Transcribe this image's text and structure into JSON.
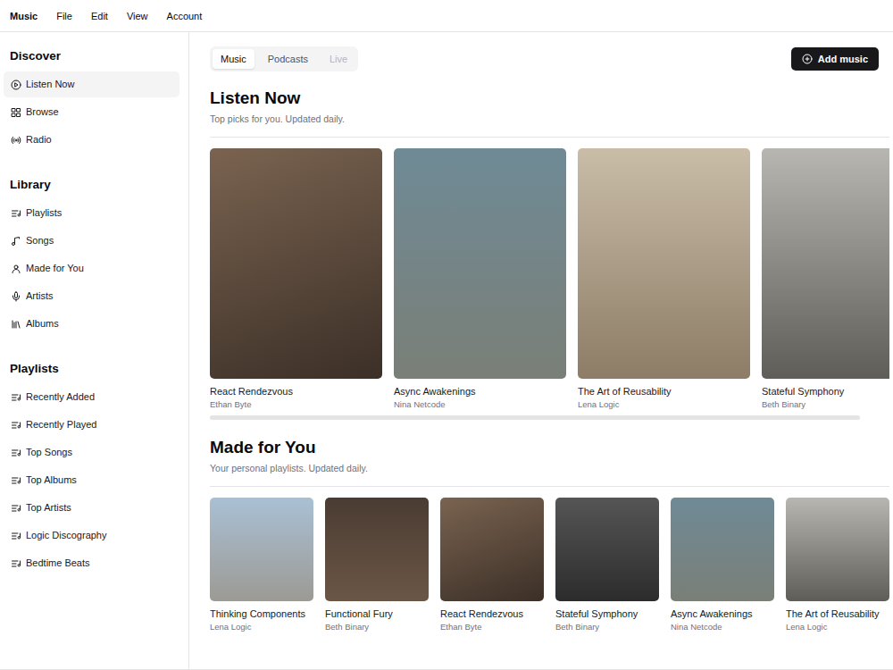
{
  "menubar": {
    "app": "Music",
    "menus": [
      "File",
      "Edit",
      "View",
      "Account"
    ]
  },
  "sidebar": [
    {
      "title": "Discover",
      "items": [
        {
          "label": "Listen Now",
          "selected": true
        },
        {
          "label": "Browse",
          "selected": false
        },
        {
          "label": "Radio",
          "selected": false
        }
      ]
    },
    {
      "title": "Library",
      "items": [
        {
          "label": "Playlists",
          "selected": false
        },
        {
          "label": "Songs",
          "selected": false
        },
        {
          "label": "Made for You",
          "selected": false
        },
        {
          "label": "Artists",
          "selected": false
        },
        {
          "label": "Albums",
          "selected": false
        }
      ]
    },
    {
      "title": "Playlists",
      "items": [
        {
          "label": "Recently Added",
          "selected": false
        },
        {
          "label": "Recently Played",
          "selected": false
        },
        {
          "label": "Top Songs",
          "selected": false
        },
        {
          "label": "Top Albums",
          "selected": false
        },
        {
          "label": "Top Artists",
          "selected": false
        },
        {
          "label": "Logic Discography",
          "selected": false
        },
        {
          "label": "Bedtime Beats",
          "selected": false
        }
      ]
    }
  ],
  "tabs": [
    {
      "label": "Music",
      "selected": true,
      "disabled": false
    },
    {
      "label": "Podcasts",
      "selected": false,
      "disabled": false
    },
    {
      "label": "Live",
      "selected": false,
      "disabled": true
    }
  ],
  "add_button": "Add music",
  "listen_now": {
    "title": "Listen Now",
    "subtitle": "Top picks for you. Updated daily.",
    "albums": [
      {
        "title": "React Rendezvous",
        "artist": "Ethan Byte"
      },
      {
        "title": "Async Awakenings",
        "artist": "Nina Netcode"
      },
      {
        "title": "The Art of Reusability",
        "artist": "Lena Logic"
      },
      {
        "title": "Stateful Symphony",
        "artist": "Beth Binary"
      }
    ],
    "scrollbar": {
      "level": 0.956
    }
  },
  "made_for_you": {
    "title": "Made for You",
    "subtitle": "Your personal playlists. Updated daily.",
    "albums": [
      {
        "title": "Thinking Components",
        "artist": "Lena Logic"
      },
      {
        "title": "Functional Fury",
        "artist": "Beth Binary"
      },
      {
        "title": "React Rendezvous",
        "artist": "Ethan Byte"
      },
      {
        "title": "Stateful Symphony",
        "artist": "Beth Binary"
      },
      {
        "title": "Async Awakenings",
        "artist": "Nina Netcode"
      },
      {
        "title": "The Art of Reusability",
        "artist": "Lena Logic"
      }
    ]
  }
}
